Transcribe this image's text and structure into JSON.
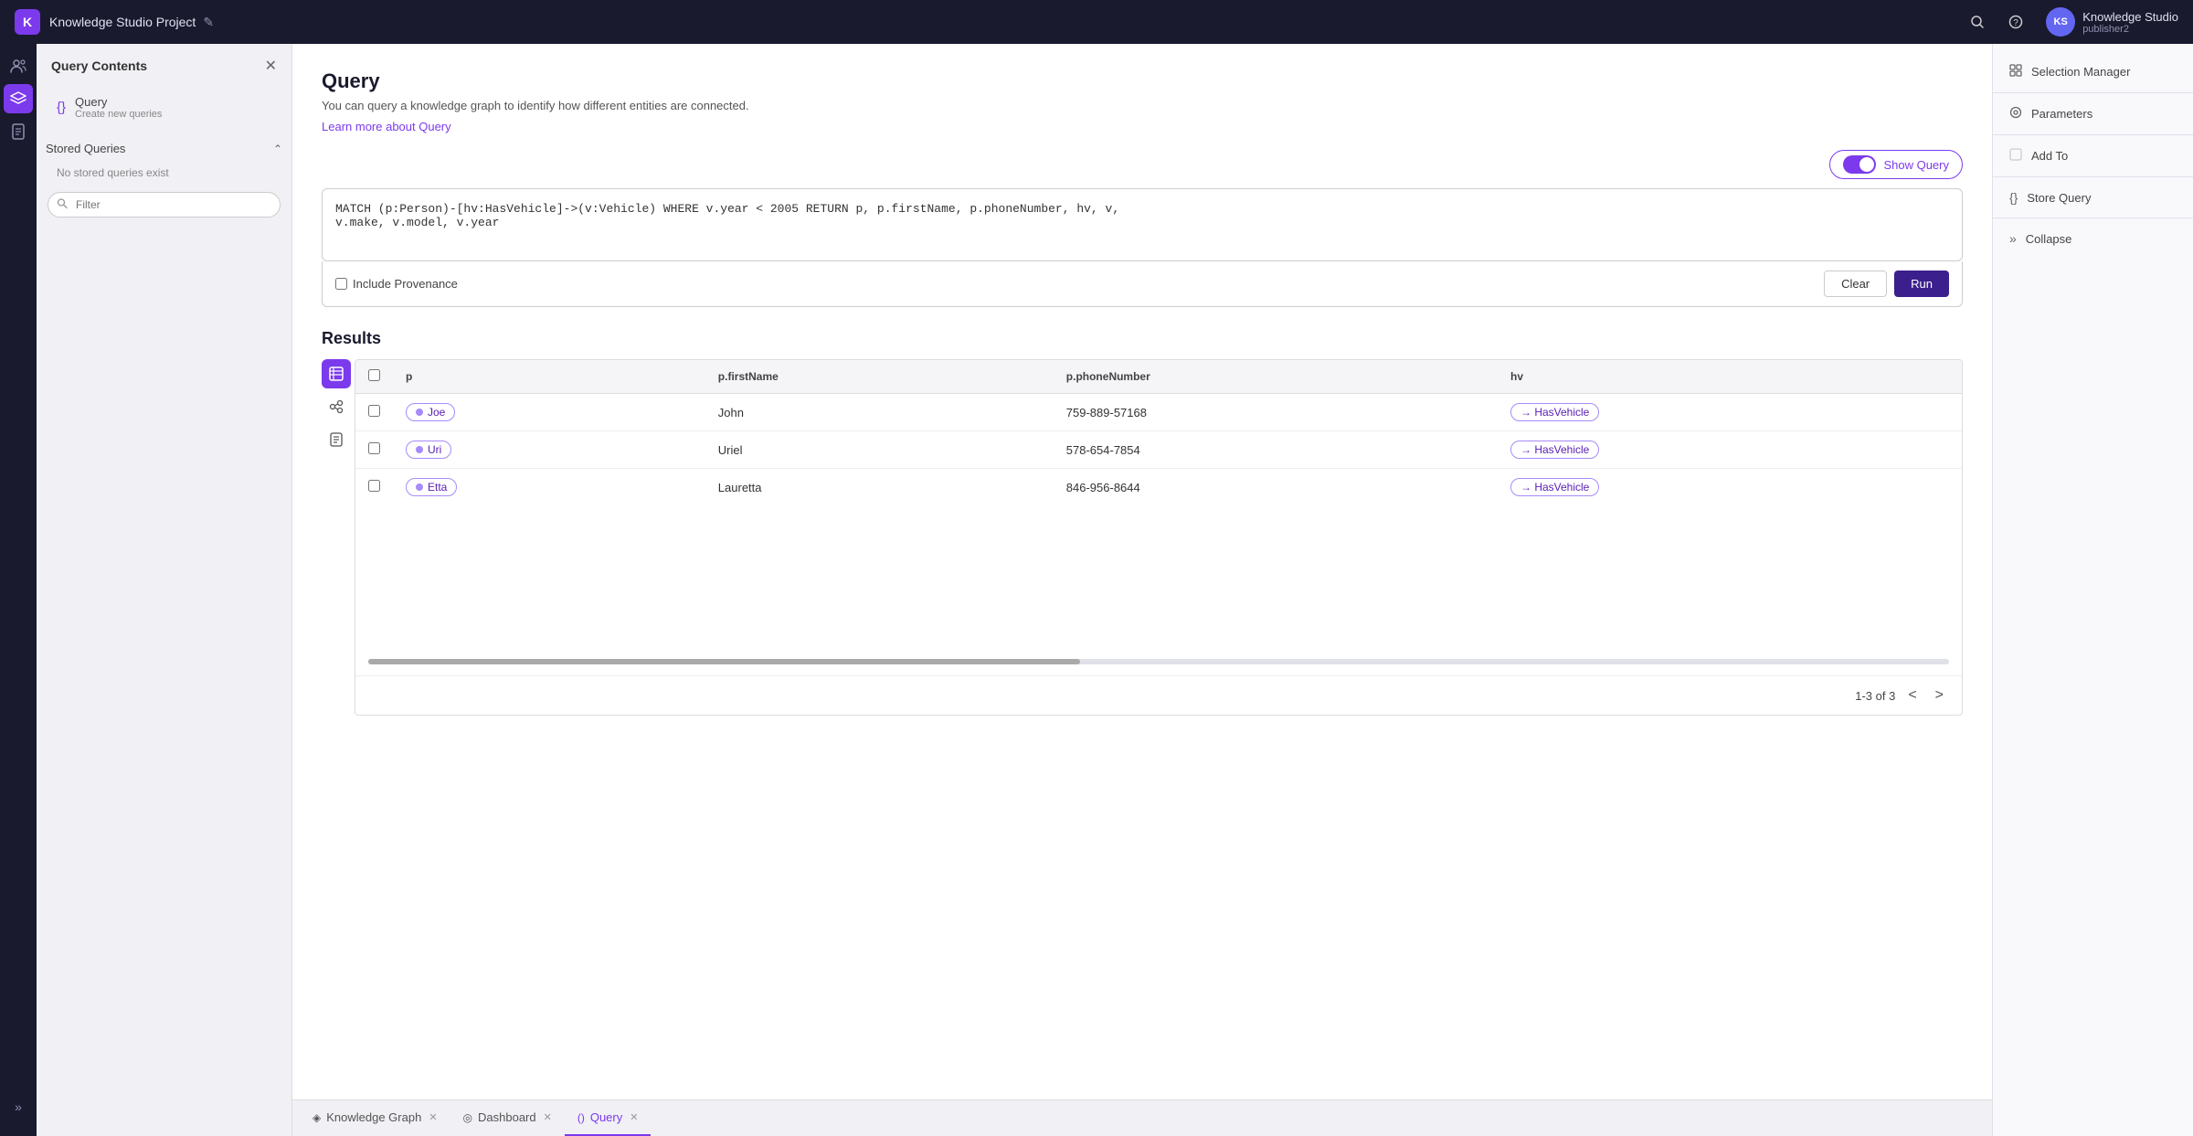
{
  "app": {
    "logo_text": "K",
    "project_title": "Knowledge Studio Project",
    "edit_icon": "✎",
    "user_initials": "KS",
    "user_name": "Knowledge Studio",
    "user_subtitle": "publisher2",
    "search_icon": "🔍",
    "help_icon": "?"
  },
  "sidebar": {
    "title": "Query Contents",
    "close_icon": "✕",
    "items": [
      {
        "icon": "{}",
        "label": "Query",
        "sublabel": "Create new queries"
      }
    ],
    "stored_queries": {
      "label": "Stored Queries",
      "sublabel": "No stored queries exist",
      "chevron": "^"
    },
    "filter": {
      "placeholder": "Filter"
    }
  },
  "query_panel": {
    "title": "Query",
    "description": "You can query a knowledge graph to identify how different entities are connected.",
    "learn_more": "Learn more about Query",
    "show_query_label": "Show Query",
    "query_text": "MATCH (p:Person)-[hv:HasVehicle]->(v:Vehicle) WHERE v.year < 2005 RETURN p, p.firstName, p.phoneNumber, hv, v,\nv.make, v.model, v.year",
    "include_provenance_label": "Include Provenance",
    "clear_button": "Clear",
    "run_button": "Run",
    "results_title": "Results",
    "pagination": {
      "info": "1-3 of 3",
      "prev_icon": "<",
      "next_icon": ">"
    },
    "columns": [
      "p",
      "p.firstName",
      "p.phoneNumber",
      "hv"
    ],
    "rows": [
      {
        "node": "Joe",
        "firstName": "John",
        "phone": "759-889-57168",
        "hv": "→ HasVehicle"
      },
      {
        "node": "Uri",
        "firstName": "Uriel",
        "phone": "578-654-7854",
        "hv": "→ HasVehicle"
      },
      {
        "node": "Etta",
        "firstName": "Lauretta",
        "phone": "846-956-8644",
        "hv": "→ HasVehicle"
      }
    ]
  },
  "right_panel": {
    "items": [
      {
        "icon": "⚙",
        "label": "Selection Manager"
      },
      {
        "icon": "⚙",
        "label": "Parameters"
      },
      {
        "icon": "□",
        "label": "Add To"
      },
      {
        "icon": "{}",
        "label": "Store Query"
      },
      {
        "icon": "»",
        "label": "Collapse"
      }
    ]
  },
  "bottom_tabs": [
    {
      "icon": "◈",
      "label": "Knowledge Graph",
      "closable": true,
      "active": false
    },
    {
      "icon": "◎",
      "label": "Dashboard",
      "closable": true,
      "active": false
    },
    {
      "icon": "()",
      "label": "Query",
      "closable": true,
      "active": true
    }
  ],
  "rail": {
    "expand_icon": "»"
  }
}
